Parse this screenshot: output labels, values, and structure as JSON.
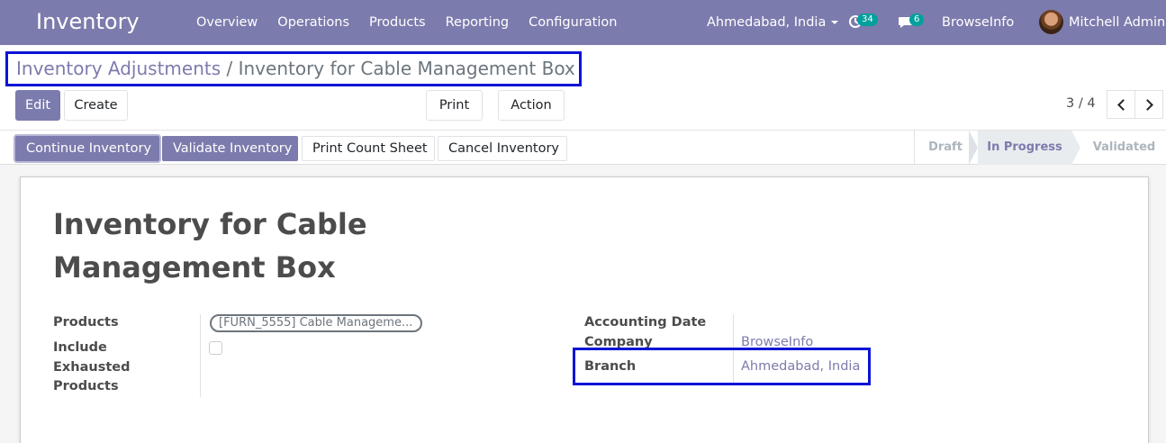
{
  "navbar": {
    "brand": "Inventory",
    "menu": [
      "Overview",
      "Operations",
      "Products",
      "Reporting",
      "Configuration"
    ],
    "branch_selector": "Ahmedabad, India",
    "activity_count": "34",
    "messages_count": "6",
    "company": "BrowseInfo",
    "user": "Mitchell Admin"
  },
  "breadcrumb": {
    "parent": "Inventory Adjustments",
    "separator": "/",
    "current": "Inventory for Cable Management Box"
  },
  "toolbar": {
    "edit": "Edit",
    "create": "Create",
    "print": "Print",
    "action": "Action"
  },
  "pager": {
    "value": "3 / 4"
  },
  "statusbar": {
    "buttons": [
      "Continue Inventory",
      "Validate Inventory",
      "Print Count Sheet",
      "Cancel Inventory"
    ],
    "stages": [
      "Draft",
      "In Progress",
      "Validated"
    ],
    "active_stage": "In Progress"
  },
  "form": {
    "title_line1": "Inventory for Cable",
    "title_line2": "Management Box",
    "products_label": "Products",
    "products_tag": "[FURN_5555] Cable Manageme...",
    "include_label_1": "Include",
    "include_label_2": "Exhausted",
    "include_label_3": "Products",
    "include_exhausted": false,
    "accounting_date_label": "Accounting Date",
    "company_label": "Company",
    "company_value": "BrowseInfo",
    "branch_label": "Branch",
    "branch_value": "Ahmedabad, India"
  },
  "colors": {
    "brand": "#7c7bad",
    "badge": "#00a09d",
    "highlight": "#0b14d6"
  }
}
